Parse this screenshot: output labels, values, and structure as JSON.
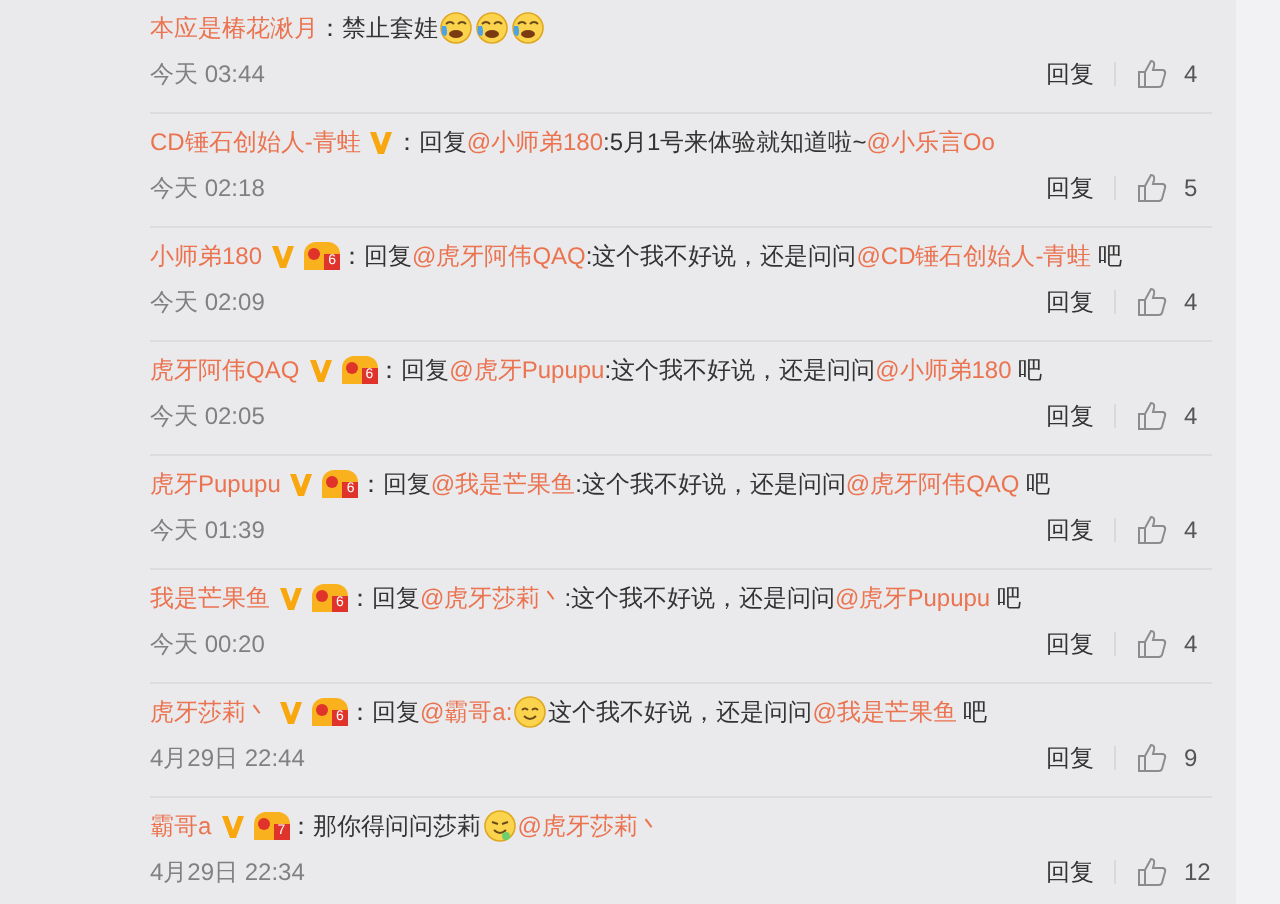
{
  "comments": [
    {
      "name": "本应是椿花湫月",
      "verified": false,
      "body": [
        {
          "kind": "text",
          "text": "：禁止套娃"
        },
        {
          "kind": "cry"
        },
        {
          "kind": "cry"
        },
        {
          "kind": "cry"
        }
      ],
      "time": "今天 03:44",
      "reply": "回复",
      "likes": "4"
    },
    {
      "name": "CD锤石创始人-青蛙",
      "verified": true,
      "body": [
        {
          "kind": "text",
          "text": "：回复"
        },
        {
          "kind": "mention",
          "text": "@小师弟180"
        },
        {
          "kind": "text",
          "text": ":5月1号来体验就知道啦~"
        },
        {
          "kind": "mention",
          "text": "@小乐言Oo"
        }
      ],
      "time": "今天 02:18",
      "reply": "回复",
      "likes": "5"
    },
    {
      "name": "小师弟180",
      "verified": true,
      "level": "6",
      "body": [
        {
          "kind": "text",
          "text": "：回复"
        },
        {
          "kind": "mention",
          "text": "@虎牙阿伟QAQ"
        },
        {
          "kind": "text",
          "text": ":这个我不好说，还是问问"
        },
        {
          "kind": "mention",
          "text": "@CD锤石创始人-青蛙"
        },
        {
          "kind": "text",
          "text": " 吧"
        }
      ],
      "time": "今天 02:09",
      "reply": "回复",
      "likes": "4"
    },
    {
      "name": "虎牙阿伟QAQ",
      "verified": true,
      "level": "6",
      "body": [
        {
          "kind": "text",
          "text": "：回复"
        },
        {
          "kind": "mention",
          "text": "@虎牙Pupupu"
        },
        {
          "kind": "text",
          "text": ":这个我不好说，还是问问"
        },
        {
          "kind": "mention",
          "text": "@小师弟180"
        },
        {
          "kind": "text",
          "text": " 吧"
        }
      ],
      "time": "今天 02:05",
      "reply": "回复",
      "likes": "4"
    },
    {
      "name": "虎牙Pupupu",
      "verified": true,
      "level": "6",
      "body": [
        {
          "kind": "text",
          "text": "：回复"
        },
        {
          "kind": "mention",
          "text": "@我是芒果鱼"
        },
        {
          "kind": "text",
          "text": ":这个我不好说，还是问问"
        },
        {
          "kind": "mention",
          "text": "@虎牙阿伟QAQ"
        },
        {
          "kind": "text",
          "text": " 吧"
        }
      ],
      "time": "今天 01:39",
      "reply": "回复",
      "likes": "4"
    },
    {
      "name": "我是芒果鱼",
      "verified": true,
      "level": "6",
      "body": [
        {
          "kind": "text",
          "text": "：回复"
        },
        {
          "kind": "mention",
          "text": "@虎牙莎莉丶"
        },
        {
          "kind": "text",
          "text": ":这个我不好说，还是问问"
        },
        {
          "kind": "mention",
          "text": "@虎牙Pupupu"
        },
        {
          "kind": "text",
          "text": " 吧"
        }
      ],
      "time": "今天 00:20",
      "reply": "回复",
      "likes": "4"
    },
    {
      "name": "虎牙莎莉丶",
      "verified": true,
      "level": "6",
      "body": [
        {
          "kind": "text",
          "text": "：回复"
        },
        {
          "kind": "mention",
          "text": "@霸哥a:"
        },
        {
          "kind": "smile"
        },
        {
          "kind": "text",
          "text": "这个我不好说，还是问问"
        },
        {
          "kind": "mention",
          "text": "@我是芒果鱼"
        },
        {
          "kind": "text",
          "text": " 吧"
        }
      ],
      "time": "4月29日 22:44",
      "reply": "回复",
      "likes": "9"
    },
    {
      "name": "霸哥a",
      "verified": true,
      "level": "7",
      "body": [
        {
          "kind": "text",
          "text": "：那你得问问莎莉"
        },
        {
          "kind": "drool"
        },
        {
          "kind": "mention",
          "text": "@虎牙莎莉丶"
        }
      ],
      "time": "4月29日 22:34",
      "reply": "回复",
      "likes": "12"
    }
  ]
}
